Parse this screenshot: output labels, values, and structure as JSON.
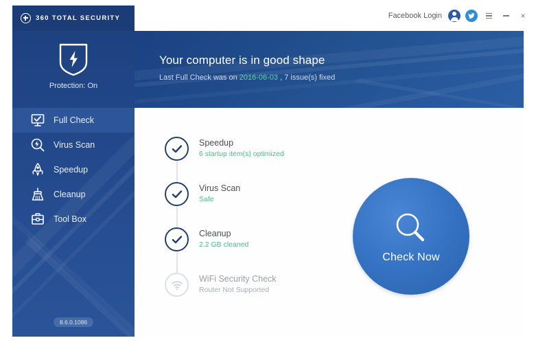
{
  "window": {
    "logo_text": "360 TOTAL SECURITY",
    "facebook_login": "Facebook Login",
    "user_icon_name": "user-account-icon",
    "twitter_icon_name": "twitter-bird-icon",
    "menu_label": "≡",
    "minimize_label": "–",
    "close_label": "×"
  },
  "sidebar": {
    "protection_status": "Protection: On",
    "shield_icon": "shield-bolt-icon",
    "version": "8.6.0.1086",
    "items": [
      {
        "label": "Full Check",
        "icon": "monitor-check-icon",
        "active": true
      },
      {
        "label": "Virus Scan",
        "icon": "magnifier-bolt-icon",
        "active": false
      },
      {
        "label": "Speedup",
        "icon": "rocket-icon",
        "active": false
      },
      {
        "label": "Cleanup",
        "icon": "broom-icon",
        "active": false
      },
      {
        "label": "Tool Box",
        "icon": "toolbox-icon",
        "active": false
      }
    ]
  },
  "banner": {
    "title": "Your computer is in good shape",
    "sub_prefix": "Last Full Check was on ",
    "date": "2016-06-03",
    "sub_suffix": " , 7 issue(s) fixed",
    "date_color": "#54d69a"
  },
  "main": {
    "checklist": [
      {
        "title": "Speedup",
        "subtitle": "6 startup item(s) optimized",
        "state": "done"
      },
      {
        "title": "Virus Scan",
        "subtitle": "Safe",
        "state": "done"
      },
      {
        "title": "Cleanup",
        "subtitle": "2.2 GB cleaned",
        "state": "done"
      },
      {
        "title": "WiFi Security Check",
        "subtitle": "Router Not Supported",
        "state": "disabled"
      }
    ],
    "check_button": {
      "label": "Check Now",
      "icon": "magnifier-icon",
      "color": "#3673c4"
    }
  }
}
